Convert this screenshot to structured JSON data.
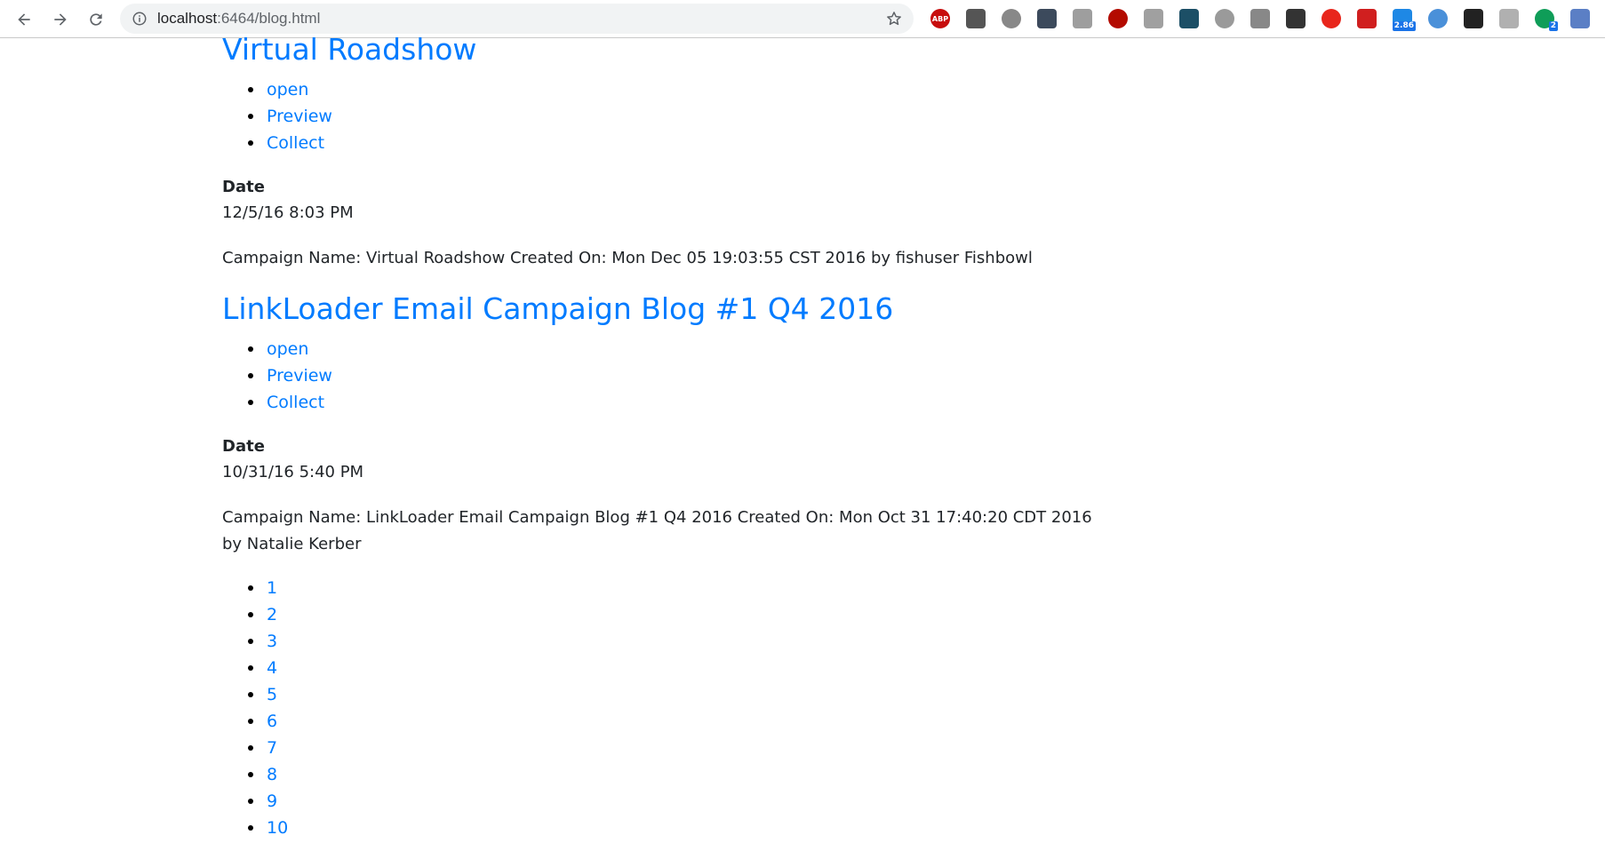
{
  "browser": {
    "url_host": "localhost",
    "url_path": ":6464/blog.html",
    "extensions": [
      {
        "name": "adblock-plus-icon",
        "label": "ABP",
        "color": "#c70d0d"
      },
      {
        "name": "extension-icon-2",
        "label": "",
        "color": "#555555"
      },
      {
        "name": "extension-icon-3",
        "label": "",
        "color": "#888888"
      },
      {
        "name": "extension-icon-4",
        "label": "",
        "color": "#3c4a5c"
      },
      {
        "name": "extension-icon-5",
        "label": "",
        "color": "#9e9e9e"
      },
      {
        "name": "pdf-icon",
        "label": "",
        "color": "#b30b00"
      },
      {
        "name": "extension-icon-7",
        "label": "",
        "color": "#a0a0a0"
      },
      {
        "name": "extension-icon-8",
        "label": "",
        "color": "#1c4f66"
      },
      {
        "name": "tag-icon",
        "label": "",
        "color": "#9a9a9a"
      },
      {
        "name": "extension-icon-10",
        "label": "",
        "color": "#888888"
      },
      {
        "name": "extension-icon-11",
        "label": "",
        "color": "#333333"
      },
      {
        "name": "extension-icon-12",
        "label": "",
        "color": "#e8261c"
      },
      {
        "name": "extension-icon-13",
        "label": "",
        "color": "#d01f1f"
      },
      {
        "name": "extension-icon-14",
        "label": "2.86",
        "color": "#1e88e5"
      },
      {
        "name": "sitemap-icon",
        "label": "",
        "color": "#4a90d9"
      },
      {
        "name": "extension-icon-16",
        "label": "",
        "color": "#222222"
      },
      {
        "name": "extension-icon-17",
        "label": "",
        "color": "#b0b0b0"
      },
      {
        "name": "extension-icon-18",
        "label": "2",
        "color": "#0f9d58"
      },
      {
        "name": "extension-icon-19",
        "label": "",
        "color": "#5b7fc5"
      }
    ]
  },
  "posts": [
    {
      "title": "Virtual Roadshow",
      "links": [
        "open",
        "Preview",
        "Collect"
      ],
      "date_label": "Date",
      "date": "12/5/16 8:03 PM",
      "description": "Campaign Name: Virtual Roadshow Created On: Mon Dec 05 19:03:55 CST 2016 by fishuser Fishbowl"
    },
    {
      "title": "LinkLoader Email Campaign Blog #1 Q4 2016",
      "links": [
        "open",
        "Preview",
        "Collect"
      ],
      "date_label": "Date",
      "date": "10/31/16 5:40 PM",
      "description": "Campaign Name: LinkLoader Email Campaign Blog #1 Q4 2016 Created On: Mon Oct 31 17:40:20 CDT 2016 by Natalie Kerber"
    }
  ],
  "pagination": [
    "1",
    "2",
    "3",
    "4",
    "5",
    "6",
    "7",
    "8",
    "9",
    "10"
  ]
}
